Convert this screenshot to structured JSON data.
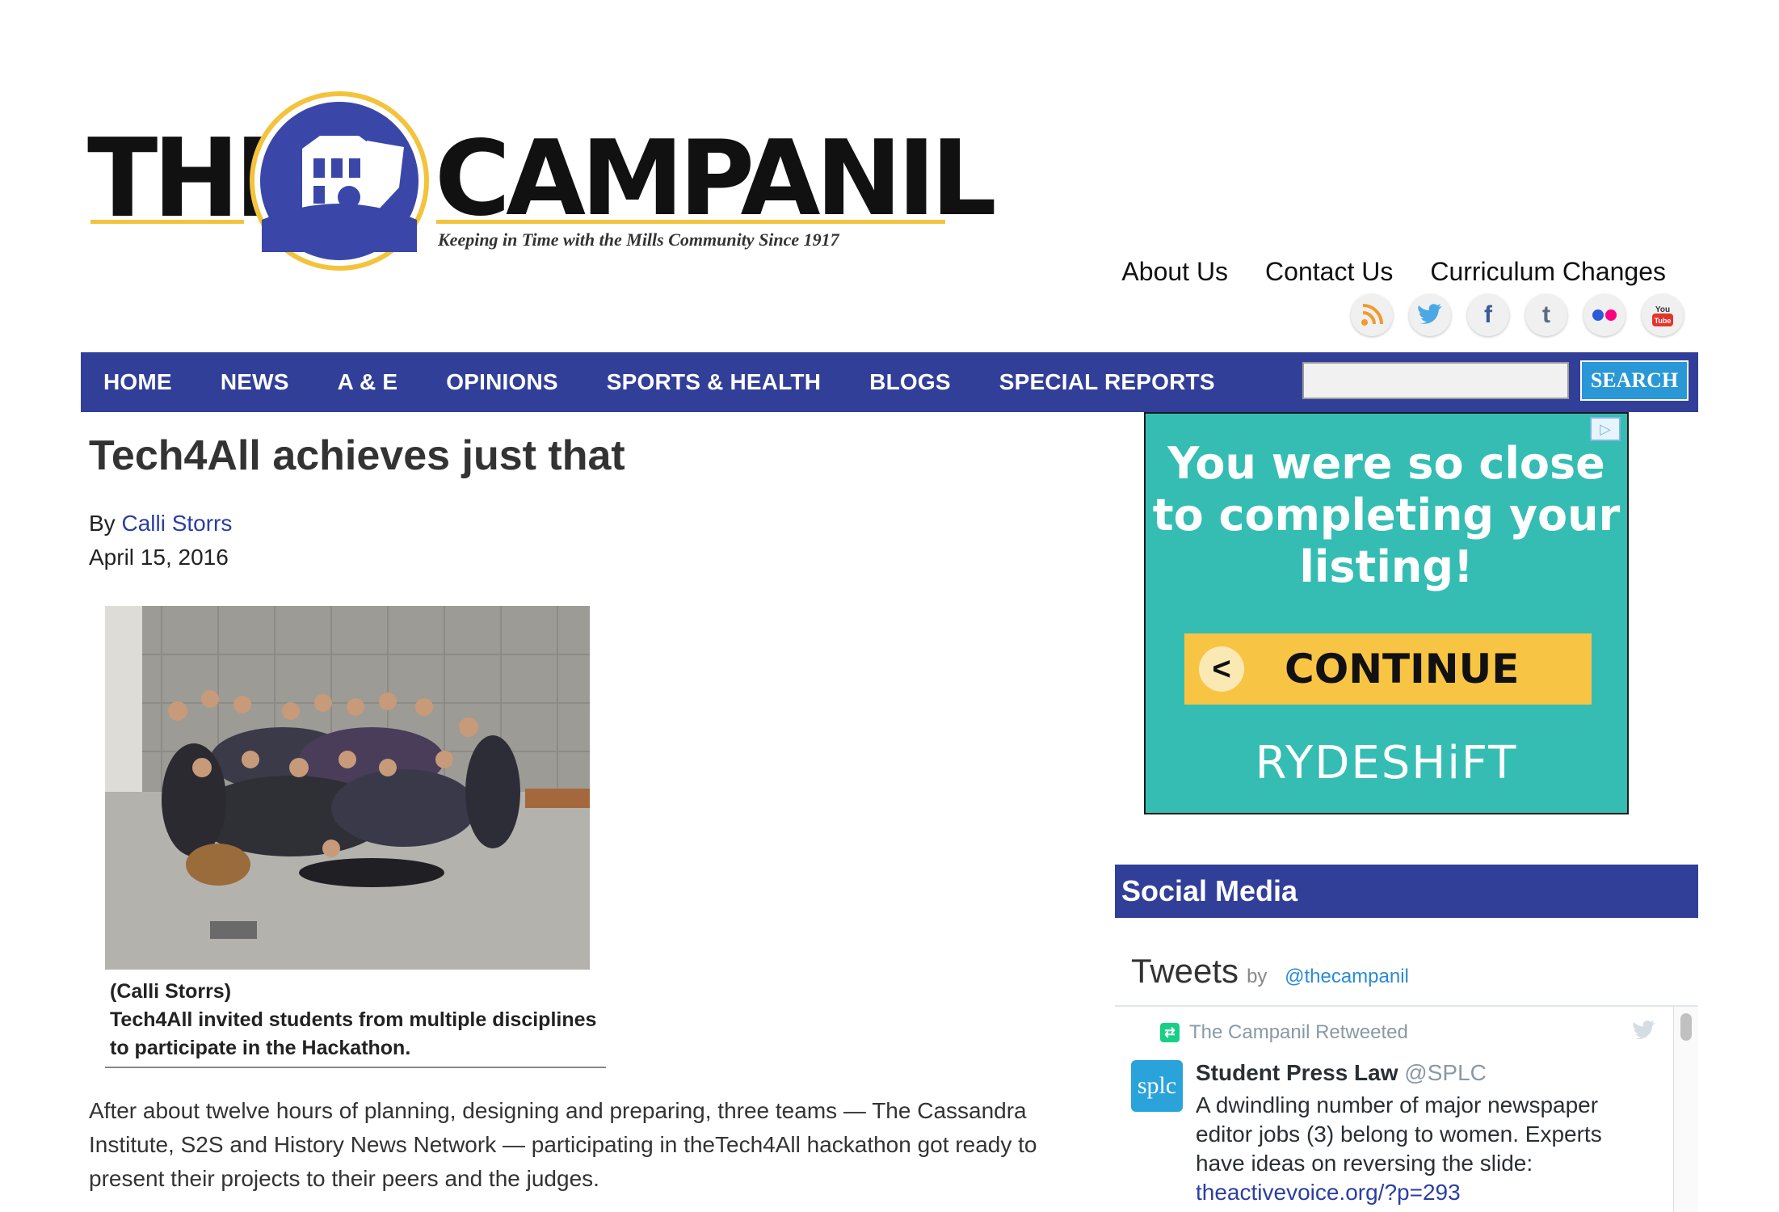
{
  "logo": {
    "part1": "THE",
    "part2": "CAMPANIL",
    "tagline": "Keeping in Time with the Mills Community Since 1917"
  },
  "top_links": [
    "About Us",
    "Contact Us",
    "Curriculum Changes"
  ],
  "social_icons": [
    "rss-icon",
    "twitter-icon",
    "facebook-icon",
    "tumblr-icon",
    "flickr-icon",
    "youtube-icon"
  ],
  "nav": {
    "items": [
      "HOME",
      "NEWS",
      "A & E",
      "OPINIONS",
      "SPORTS & HEALTH",
      "BLOGS",
      "SPECIAL REPORTS"
    ],
    "search_label": "SEARCH",
    "search_value": ""
  },
  "article": {
    "title": "Tech4All achieves just that",
    "by_prefix": "By",
    "author": "Calli Storrs",
    "date": "April 15, 2016",
    "photo_credit": "(Calli Storrs)",
    "caption": "Tech4All invited students from multiple disciplines to participate in the Hackathon.",
    "body": "After about twelve hours of planning, designing and preparing, three teams — The Cassandra Institute, S2S and History News Network — participating in theTech4All hackathon got ready to present their projects to their peers and the judges."
  },
  "ad": {
    "badge": "▷",
    "headline": "You were so close to completing your listing!",
    "button_label": "CONTINUE",
    "button_icon": "<",
    "brand": "RYDESHiFT",
    "colors": {
      "background": "#35bdb3",
      "button": "#f8c444"
    }
  },
  "sidebar": {
    "social_media_title": "Social Media",
    "tweets_title": "Tweets",
    "tweets_by": "by",
    "tweets_handle": "@thecampanil",
    "retweet_notice": "The Campanil Retweeted",
    "tweet": {
      "avatar_text": "splc",
      "author_name": "Student Press Law",
      "author_handle": "@SPLC",
      "text": "A dwindling number of major newspaper editor jobs (3) belong to women. Experts have ideas on reversing the slide:",
      "link": "theactivevoice.org/?p=293"
    }
  },
  "colors": {
    "nav": "#323f99",
    "accent_yellow": "#f3c33b",
    "search_button": "#2a98d6",
    "link": "#2b3ea3"
  }
}
